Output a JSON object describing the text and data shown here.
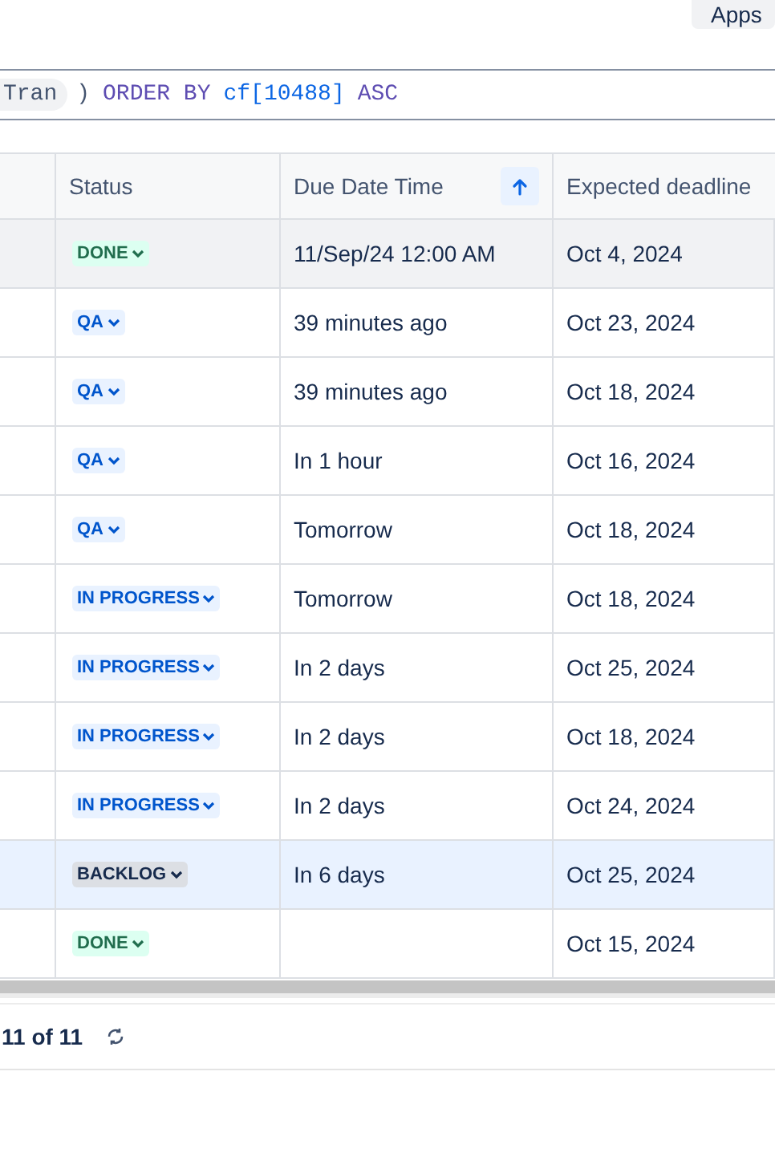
{
  "top_bar": {
    "apps_button": "Apps"
  },
  "query": [
    {
      "kind": "pill",
      "text": "Tran"
    },
    {
      "kind": "plain",
      "text": ")"
    },
    {
      "kind": "keyword",
      "text": "ORDER BY"
    },
    {
      "kind": "field",
      "text": "cf[10488]"
    },
    {
      "kind": "keyword",
      "text": "ASC"
    }
  ],
  "table": {
    "columns": [
      {
        "sorted": false
      },
      {
        "label": "Status",
        "sorted": false
      },
      {
        "label": "Due Date Time",
        "sorted": true
      },
      {
        "label": "Expected deadline",
        "sorted": false
      }
    ],
    "rows": [
      {
        "hovered": true,
        "selected": false,
        "status": {
          "kind": "done",
          "label": "DONE"
        },
        "due": "11/Sep/24 12:00 AM",
        "deadline": "Oct 4, 2024"
      },
      {
        "hovered": false,
        "selected": false,
        "status": {
          "kind": "active",
          "label": "QA"
        },
        "due": "39 minutes ago",
        "deadline": "Oct 23, 2024"
      },
      {
        "hovered": false,
        "selected": false,
        "status": {
          "kind": "active",
          "label": "QA"
        },
        "due": "39 minutes ago",
        "deadline": "Oct 18, 2024"
      },
      {
        "hovered": false,
        "selected": false,
        "status": {
          "kind": "active",
          "label": "QA"
        },
        "due": "In 1 hour",
        "deadline": "Oct 16, 2024"
      },
      {
        "hovered": false,
        "selected": false,
        "status": {
          "kind": "active",
          "label": "QA"
        },
        "due": "Tomorrow",
        "deadline": "Oct 18, 2024"
      },
      {
        "hovered": false,
        "selected": false,
        "status": {
          "kind": "active",
          "label": "IN PROGRESS"
        },
        "due": "Tomorrow",
        "deadline": "Oct 18, 2024"
      },
      {
        "hovered": false,
        "selected": false,
        "status": {
          "kind": "active",
          "label": "IN PROGRESS"
        },
        "due": "In 2 days",
        "deadline": "Oct 25, 2024"
      },
      {
        "hovered": false,
        "selected": false,
        "status": {
          "kind": "active",
          "label": "IN PROGRESS"
        },
        "due": "In 2 days",
        "deadline": "Oct 18, 2024"
      },
      {
        "hovered": false,
        "selected": false,
        "status": {
          "kind": "active",
          "label": "IN PROGRESS"
        },
        "due": "In 2 days",
        "deadline": "Oct 24, 2024"
      },
      {
        "hovered": false,
        "selected": true,
        "status": {
          "kind": "todo",
          "label": "BACKLOG"
        },
        "due": "In 6 days",
        "deadline": "Oct 25, 2024"
      },
      {
        "hovered": false,
        "selected": false,
        "status": {
          "kind": "done",
          "label": "DONE"
        },
        "deadline": "Oct 15, 2024"
      }
    ]
  },
  "footer": {
    "count": "11 of 11"
  }
}
